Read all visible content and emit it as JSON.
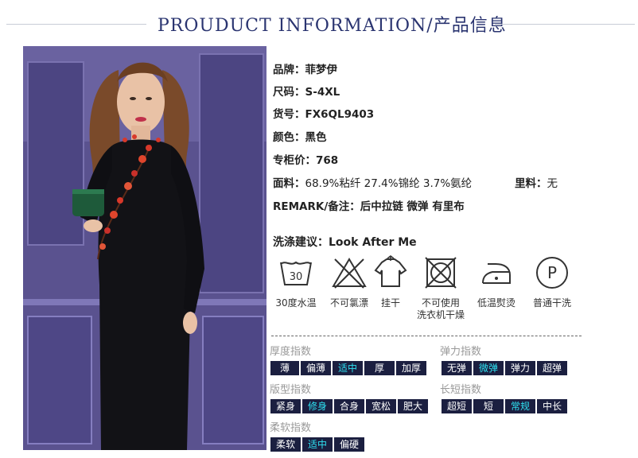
{
  "header": {
    "title": "PROUDUCT INFORMATION/产品信息"
  },
  "specs": [
    {
      "label": "品牌：",
      "value": "菲梦伊"
    },
    {
      "label": "尺码：",
      "value": "S-4XL"
    },
    {
      "label": "货号：",
      "value": "FX6QL9403"
    },
    {
      "label": "颜色：",
      "value": "黑色"
    },
    {
      "label": "专柜价：",
      "value": "768"
    }
  ],
  "fabric": {
    "label": "面料：",
    "value": "68.9%粘纤 27.4%锦纶 3.7%氨纶",
    "lining_label": "里料：",
    "lining_value": "无"
  },
  "remark": {
    "label": "REMARK/备注：",
    "value": "后中拉链 微弹 有里布"
  },
  "washing": {
    "label": "洗涤建议：",
    "value": "Look After Me",
    "icons": [
      {
        "icon": "wash-30-icon",
        "label": "30度水温",
        "number": "30"
      },
      {
        "icon": "no-bleach-icon",
        "label": "不可氯漂"
      },
      {
        "icon": "hang-dry-icon",
        "label": "挂干"
      },
      {
        "icon": "no-tumble-dry-icon",
        "label": "不可使用\n洗衣机干燥"
      },
      {
        "icon": "low-iron-icon",
        "label": "低温熨烫"
      },
      {
        "icon": "dry-clean-icon",
        "label": "普通干洗",
        "letter": "P"
      }
    ]
  },
  "indices": {
    "thickness": {
      "title": "厚度指数",
      "options": [
        "薄",
        "偏薄",
        "适中",
        "厚",
        "加厚"
      ],
      "selected": "适中"
    },
    "elasticity": {
      "title": "弹力指数",
      "options": [
        "无弹",
        "微弹",
        "弹力",
        "超弹"
      ],
      "selected": "微弹"
    },
    "fit": {
      "title": "版型指数",
      "options": [
        "紧身",
        "修身",
        "合身",
        "宽松",
        "肥大"
      ],
      "selected": "修身"
    },
    "length": {
      "title": "长短指数",
      "options": [
        "超短",
        "短",
        "常规",
        "中长"
      ],
      "selected": "常规"
    },
    "softness": {
      "title": "柔软指数",
      "options": [
        "柔软",
        "适中",
        "偏硬"
      ],
      "selected": "适中"
    }
  },
  "colors": {
    "title": "#2a3470",
    "chip_bg": "#1b1f40",
    "chip_selected_text": "#2ee0f0",
    "photo_bg": "#544c88"
  }
}
